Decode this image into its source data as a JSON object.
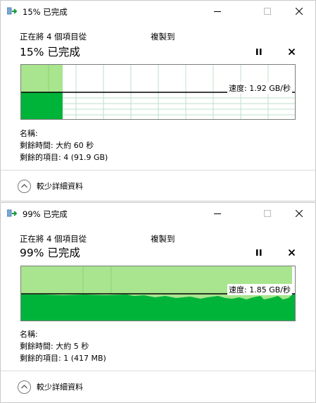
{
  "colors": {
    "chart_fill": "#00b43a",
    "chart_history": "#a8e58e",
    "grid": "#bde0c8",
    "speed_line": "#000000"
  },
  "dialogs": [
    {
      "title": "15% 已完成",
      "from_line": "正在將 4 個項目從",
      "destination": "複製到",
      "percent_text": "15% 已完成",
      "progress": 0.15,
      "speed_label": "速度: 1.92 GB/秒",
      "name_line": "名稱:",
      "time_remaining": "剩餘時間: 大約 60 秒",
      "items_remaining": "剩餘的項目: 4 (91.9 GB)",
      "more_label": "較少詳細資料"
    },
    {
      "title": "99% 已完成",
      "from_line": "正在將 4 個項目從",
      "destination": "複製到",
      "percent_text": "99% 已完成",
      "progress": 0.99,
      "speed_label": "速度: 1.85 GB/秒",
      "name_line": "名稱:",
      "time_remaining": "剩餘時間: 大約 5 秒",
      "items_remaining": "剩餘的項目: 1 (417 MB)",
      "more_label": "較少詳細資料"
    }
  ]
}
